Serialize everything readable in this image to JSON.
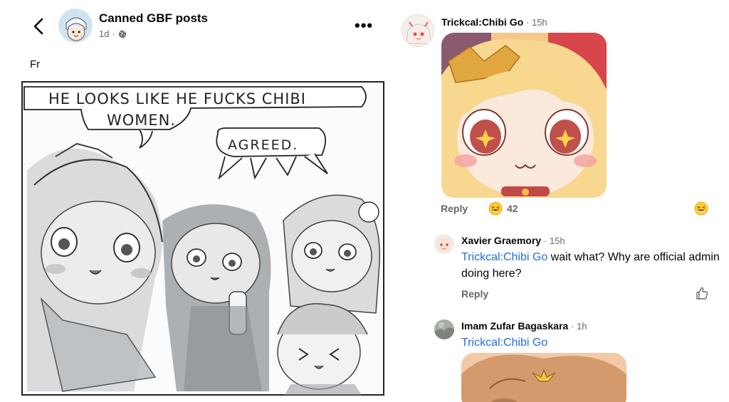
{
  "post": {
    "page_name": "Canned GBF posts",
    "time": "1d",
    "separator": "·",
    "text": "Fr",
    "more": "•••",
    "comic": {
      "speech_1_line1": "HE LOOKS LIKE  HE FUCKS CHIBI",
      "speech_1_line2": "WOMEN.",
      "speech_2": "AGREED."
    }
  },
  "comments": [
    {
      "author": "Trickcal:Chibi Go",
      "time": "· 15h",
      "reply_label": "Reply",
      "reaction_count": "42"
    },
    {
      "author": "Xavier Graemory",
      "time": "· 15h",
      "mention": "Trickcal:Chibi Go",
      "text": " wait what? Why are official admin doing here?",
      "reply_label": "Reply"
    },
    {
      "author": "Imam Zufar Bagaskara",
      "time": "· 1h",
      "mention": "Trickcal:Chibi Go"
    }
  ],
  "colors": {
    "link": "#216fdb",
    "secondary_text": "#65676b",
    "primary_text": "#050505"
  },
  "icons": [
    "back-chevron-icon",
    "globe-icon",
    "more-icon",
    "laughing-emoji-icon",
    "thumbs-up-icon"
  ]
}
